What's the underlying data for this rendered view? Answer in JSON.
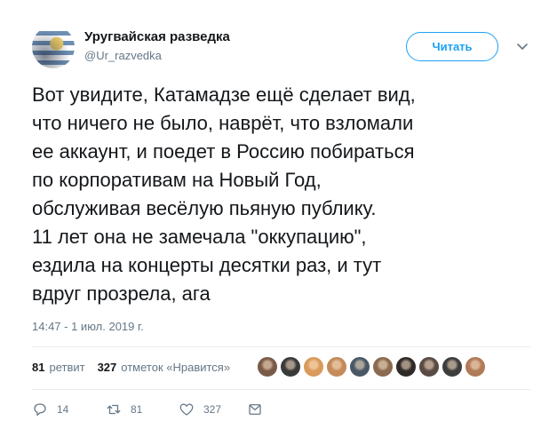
{
  "account": {
    "name": "Уругвайская разведка",
    "handle": "@Ur_razvedka",
    "avatar_icon": "uruguay-flag-avatar"
  },
  "follow_button": {
    "label": "Читать"
  },
  "tweet": {
    "lines": [
      "Вот увидите, Катамадзе ещё сделает вид,",
      "что ничего не было, наврёт, что взломали",
      "ее аккаунт, и поедет в Россию побираться",
      "по корпоративам на Новый Год,",
      "обслуживая весёлую пьяную публику.",
      "11 лет она не замечала \"оккупацию\",",
      "ездила на концерты десятки раз, и тут",
      "вдруг прозрела, ага"
    ],
    "timestamp": "14:47 - 1 июл. 2019 г."
  },
  "stats": {
    "retweets_count": "81",
    "retweets_label": "ретвит",
    "likes_count": "327",
    "likes_label": "отметок «Нравится»"
  },
  "likers": {
    "count_shown": 10,
    "colors": [
      "#7a5a48",
      "#3a3a3a",
      "#d99a5c",
      "#c48a5a",
      "#4a5866",
      "#8a6a50",
      "#2e2a28",
      "#5a4a44",
      "#3d3d3d",
      "#b07a58"
    ]
  },
  "actions": {
    "reply_count": "14",
    "retweet_count": "81",
    "like_count": "327"
  },
  "colors": {
    "accent": "#1da1f2",
    "secondary_text": "#657786",
    "primary_text": "#14171a",
    "divider": "#e6ecf0"
  }
}
